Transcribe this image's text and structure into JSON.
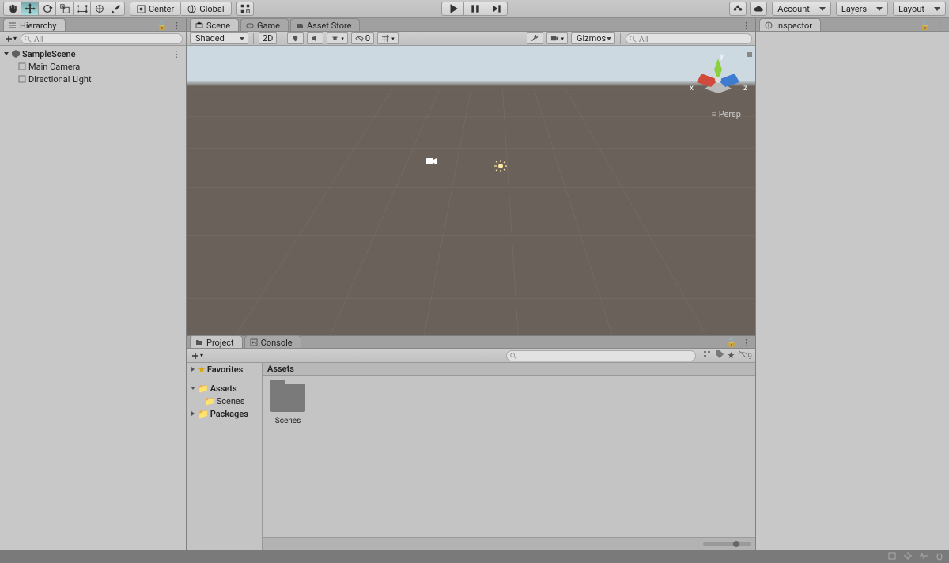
{
  "toolbar": {
    "pivot_label": "Center",
    "space_label": "Global",
    "account_label": "Account",
    "layers_label": "Layers",
    "layout_label": "Layout"
  },
  "hierarchy": {
    "tab_label": "Hierarchy",
    "search_placeholder": "All",
    "scene_name": "SampleScene",
    "items": [
      "Main Camera",
      "Directional Light"
    ]
  },
  "scene": {
    "tabs": [
      "Scene",
      "Game",
      "Asset Store"
    ],
    "shading_mode": "Shaded",
    "toggle_2d": "2D",
    "gizmos_label": "Gizmos",
    "visibility_count": "0",
    "search_placeholder": "All",
    "axis": {
      "x": "x",
      "y": "y",
      "z": "z"
    },
    "projection": "Persp"
  },
  "project": {
    "tab_project": "Project",
    "tab_console": "Console",
    "hidden_count": "9",
    "tree": {
      "favorites": "Favorites",
      "assets": "Assets",
      "scenes": "Scenes",
      "packages": "Packages"
    },
    "breadcrumb": "Assets",
    "items": [
      {
        "name": "Scenes",
        "type": "folder"
      }
    ]
  },
  "inspector": {
    "tab_label": "Inspector"
  }
}
